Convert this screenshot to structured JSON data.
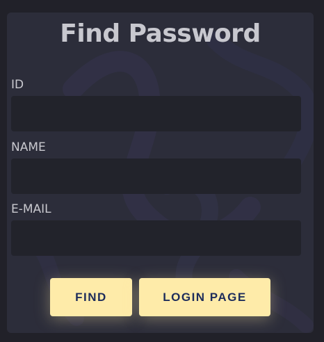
{
  "form": {
    "title": "Find Password",
    "fields": [
      {
        "label": "ID",
        "value": "",
        "placeholder": ""
      },
      {
        "label": "NAME",
        "value": "",
        "placeholder": ""
      },
      {
        "label": "E-MAIL",
        "value": "",
        "placeholder": ""
      }
    ],
    "buttons": {
      "find": "FIND",
      "login_page": "LOGIN PAGE"
    }
  },
  "colors": {
    "page_background": "#212129",
    "card_background": "#2c2d3a",
    "input_background": "#22232b",
    "text": "#c9c9cf",
    "button_background": "#feeba9",
    "button_text": "#1d2c5b"
  }
}
